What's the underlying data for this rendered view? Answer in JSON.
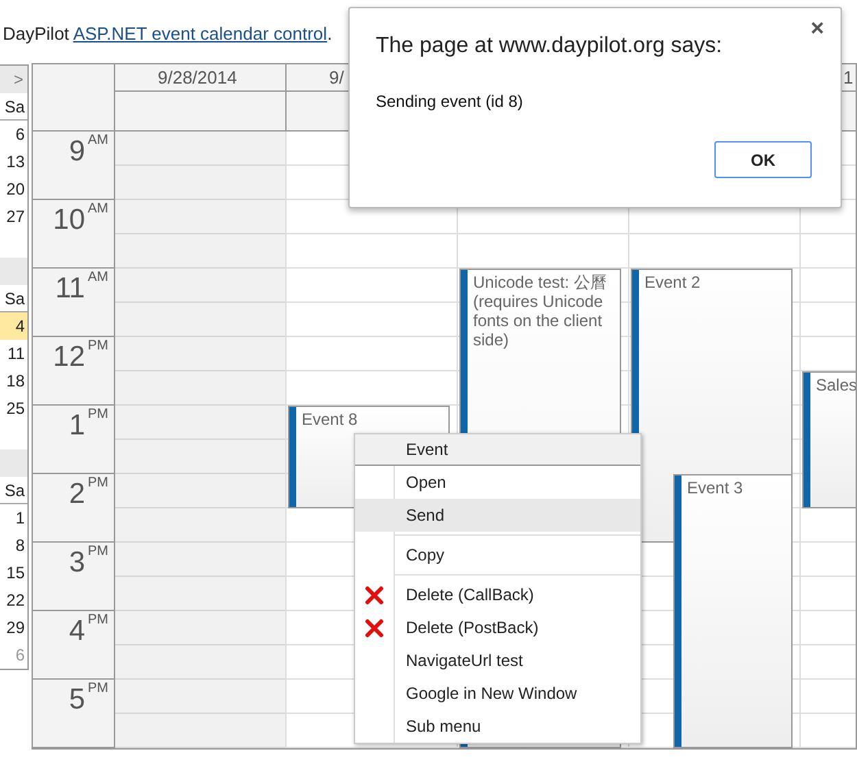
{
  "intro": {
    "text": "DayPilot ",
    "link": "ASP.NET event calendar control",
    "after": "."
  },
  "navigator": {
    "next": ">",
    "months": [
      {
        "day_header": "Sa",
        "days": [
          {
            "label": "6",
            "selected": false,
            "other_month": false
          },
          {
            "label": "13",
            "selected": false,
            "other_month": false
          },
          {
            "label": "20",
            "selected": false,
            "other_month": false
          },
          {
            "label": "27",
            "selected": false,
            "other_month": false
          }
        ]
      },
      {
        "day_header": "Sa",
        "days": [
          {
            "label": "4",
            "selected": true,
            "other_month": false
          },
          {
            "label": "11",
            "selected": false,
            "other_month": false
          },
          {
            "label": "18",
            "selected": false,
            "other_month": false
          },
          {
            "label": "25",
            "selected": false,
            "other_month": false
          }
        ]
      },
      {
        "day_header": "Sa",
        "days": [
          {
            "label": "1",
            "selected": false,
            "other_month": false
          },
          {
            "label": "8",
            "selected": false,
            "other_month": false
          },
          {
            "label": "15",
            "selected": false,
            "other_month": false
          },
          {
            "label": "22",
            "selected": false,
            "other_month": false
          },
          {
            "label": "29",
            "selected": false,
            "other_month": false
          },
          {
            "label": "6",
            "selected": false,
            "other_month": true
          }
        ]
      }
    ]
  },
  "calendar": {
    "hours": [
      {
        "hour": "9",
        "ampm": "AM"
      },
      {
        "hour": "10",
        "ampm": "AM"
      },
      {
        "hour": "11",
        "ampm": "AM"
      },
      {
        "hour": "12",
        "ampm": "PM"
      },
      {
        "hour": "1",
        "ampm": "PM"
      },
      {
        "hour": "2",
        "ampm": "PM"
      },
      {
        "hour": "3",
        "ampm": "PM"
      },
      {
        "hour": "4",
        "ampm": "PM"
      },
      {
        "hour": "5",
        "ampm": "PM"
      }
    ],
    "columns": [
      {
        "header": "9/28/2014",
        "shaded": true
      },
      {
        "header": "9/",
        "shaded": false,
        "events": [
          {
            "text": "Event 8"
          }
        ]
      },
      {
        "shaded": false,
        "events": [
          {
            "text": "Unicode test: 公曆 (requires Unicode fonts on the client side)"
          }
        ]
      },
      {
        "shaded": false,
        "events": [
          {
            "text": "Event 2"
          },
          {
            "text": "Event 3"
          }
        ]
      },
      {
        "header": "1",
        "shaded": false,
        "events": [
          {
            "text": "Sales"
          }
        ]
      }
    ]
  },
  "dialog": {
    "title": "The page at www.daypilot.org says:",
    "close": "×",
    "message": "Sending event (id 8)",
    "button": "OK"
  },
  "context_menu": {
    "header": "Event",
    "items": [
      {
        "kind": "item",
        "label": "Open",
        "selected": false
      },
      {
        "kind": "item",
        "label": "Send",
        "selected": true
      },
      {
        "kind": "separator"
      },
      {
        "kind": "item",
        "label": "Copy",
        "selected": false
      },
      {
        "kind": "separator"
      },
      {
        "kind": "delete_item",
        "label": "Delete (CallBack)",
        "selected": false
      },
      {
        "kind": "delete_item",
        "label": "Delete (PostBack)",
        "selected": false
      },
      {
        "kind": "item",
        "label": "NavigateUrl test",
        "selected": false
      },
      {
        "kind": "item",
        "label": "Google in New Window",
        "selected": false
      },
      {
        "kind": "item",
        "label": "Sub menu",
        "selected": false
      }
    ]
  }
}
